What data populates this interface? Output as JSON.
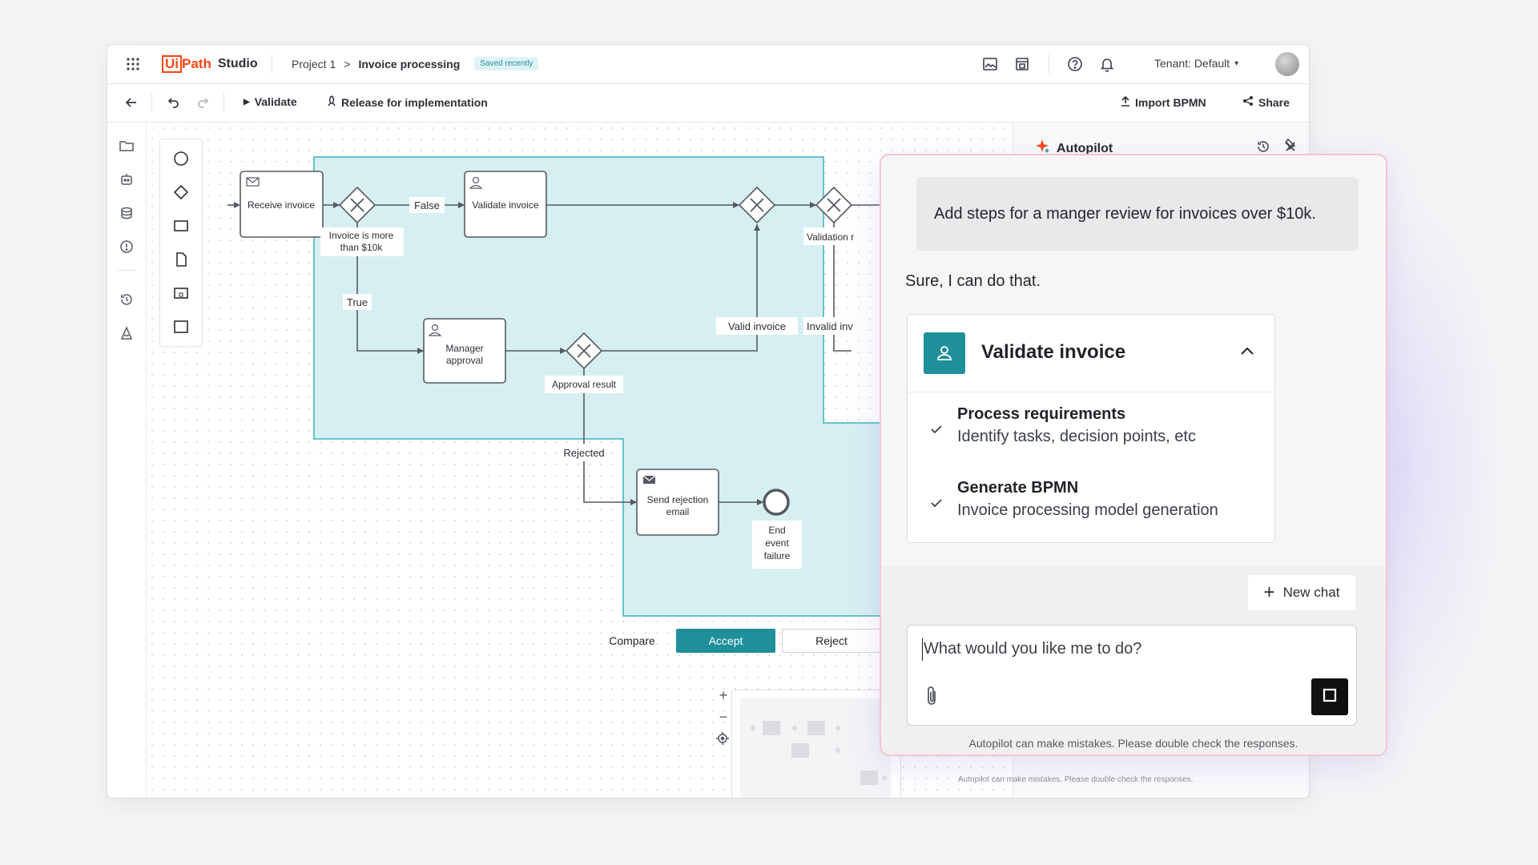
{
  "app": {
    "logo_ui": "Ui",
    "logo_path": "Path",
    "logo_studio": "Studio",
    "breadcrumb_project": "Project 1",
    "breadcrumb_sep": ">",
    "breadcrumb_process": "Invoice processing",
    "saved_badge": "Saved recently",
    "tenant": "Tenant: Default",
    "brand_color": "#fa4616",
    "accent_color": "#1f8f9a"
  },
  "toolbar": {
    "validate": "Validate",
    "release": "Release for implementation",
    "import_bpmn": "Import BPMN",
    "share": "Share"
  },
  "diagram": {
    "receive_invoice": "Receive invoice",
    "validate_invoice": "Validate invoice",
    "manager_approval_1": "Manager",
    "manager_approval_2": "approval",
    "send_rejection_1": "Send rejection",
    "send_rejection_2": "email",
    "gw1_label_1": "Invoice is more",
    "gw1_label_2": "than $10k",
    "edge_false": "False",
    "edge_true": "True",
    "approval_result": "Approval result",
    "valid_invoice": "Valid invoice",
    "rejected": "Rejected",
    "validation_r": "Validation r",
    "invalid_inv": "Invalid inv",
    "end_1": "End",
    "end_2": "event",
    "end_3": "failure",
    "highlight_color": "#d6eff2"
  },
  "actions": {
    "compare": "Compare",
    "accept": "Accept",
    "reject": "Reject"
  },
  "autopilot": {
    "title": "Autopilot",
    "user_prompt": "Add steps for a manger review for invoices over $10k.",
    "reply": "Sure, I can do that.",
    "card_title": "Validate invoice",
    "steps": [
      {
        "title": "Process requirements",
        "desc": "Identify tasks, decision points, etc"
      },
      {
        "title": "Generate BPMN",
        "desc": "Invoice processing model generation"
      }
    ],
    "new_chat": "New chat",
    "input_placeholder": "What would you like me to do?",
    "disclaimer": "Autopilot can make mistakes. Please double check the responses."
  }
}
